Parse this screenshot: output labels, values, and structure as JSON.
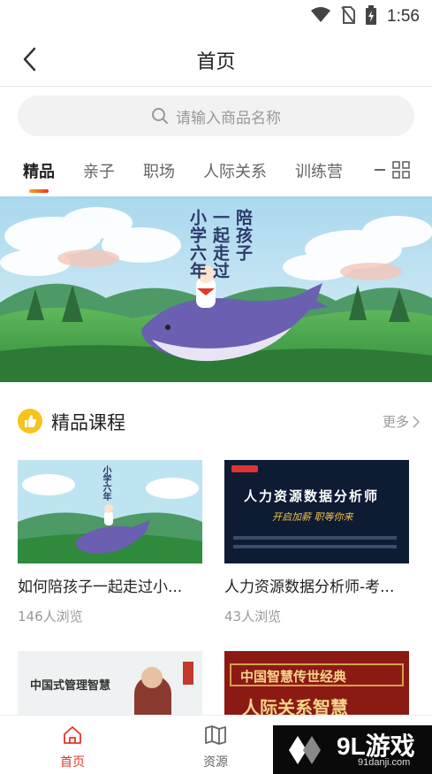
{
  "status_bar": {
    "time": "1:56"
  },
  "header": {
    "title": "首页"
  },
  "search": {
    "placeholder": "请输入商品名称"
  },
  "tabs": [
    {
      "label": "精品",
      "active": true
    },
    {
      "label": "亲子"
    },
    {
      "label": "职场"
    },
    {
      "label": "人际关系"
    },
    {
      "label": "训练营"
    }
  ],
  "banner": {
    "title_col1": "陪孩子",
    "title_col2": "一起走过",
    "title_col3": "小学六年"
  },
  "section": {
    "title": "精品课程",
    "more_label": "更多"
  },
  "courses": [
    {
      "title": "如何陪孩子一起走过小...",
      "views": "146人浏览",
      "thumb_text": "小学六年"
    },
    {
      "title": "人力资源数据分析师-考...",
      "views": "43人浏览",
      "thumb_text": "人力资源数据分析师",
      "thumb_sub": "开启加薪  职等你来"
    },
    {
      "title": "",
      "views": "",
      "thumb_text": "中国式管理智慧"
    },
    {
      "title": "",
      "views": "",
      "thumb_text": "中国智慧传世经典",
      "thumb_sub": "人际关系智慧"
    }
  ],
  "bottom_nav": [
    {
      "label": "首页",
      "active": true,
      "icon": "home-icon"
    },
    {
      "label": "资源",
      "active": false,
      "icon": "book-icon"
    }
  ],
  "watermark": {
    "logo": "9L游戏",
    "url": "91danji.com"
  },
  "colors": {
    "accent": "#e2372b",
    "section_icon": "#f7c31d",
    "text_muted": "#999999"
  }
}
